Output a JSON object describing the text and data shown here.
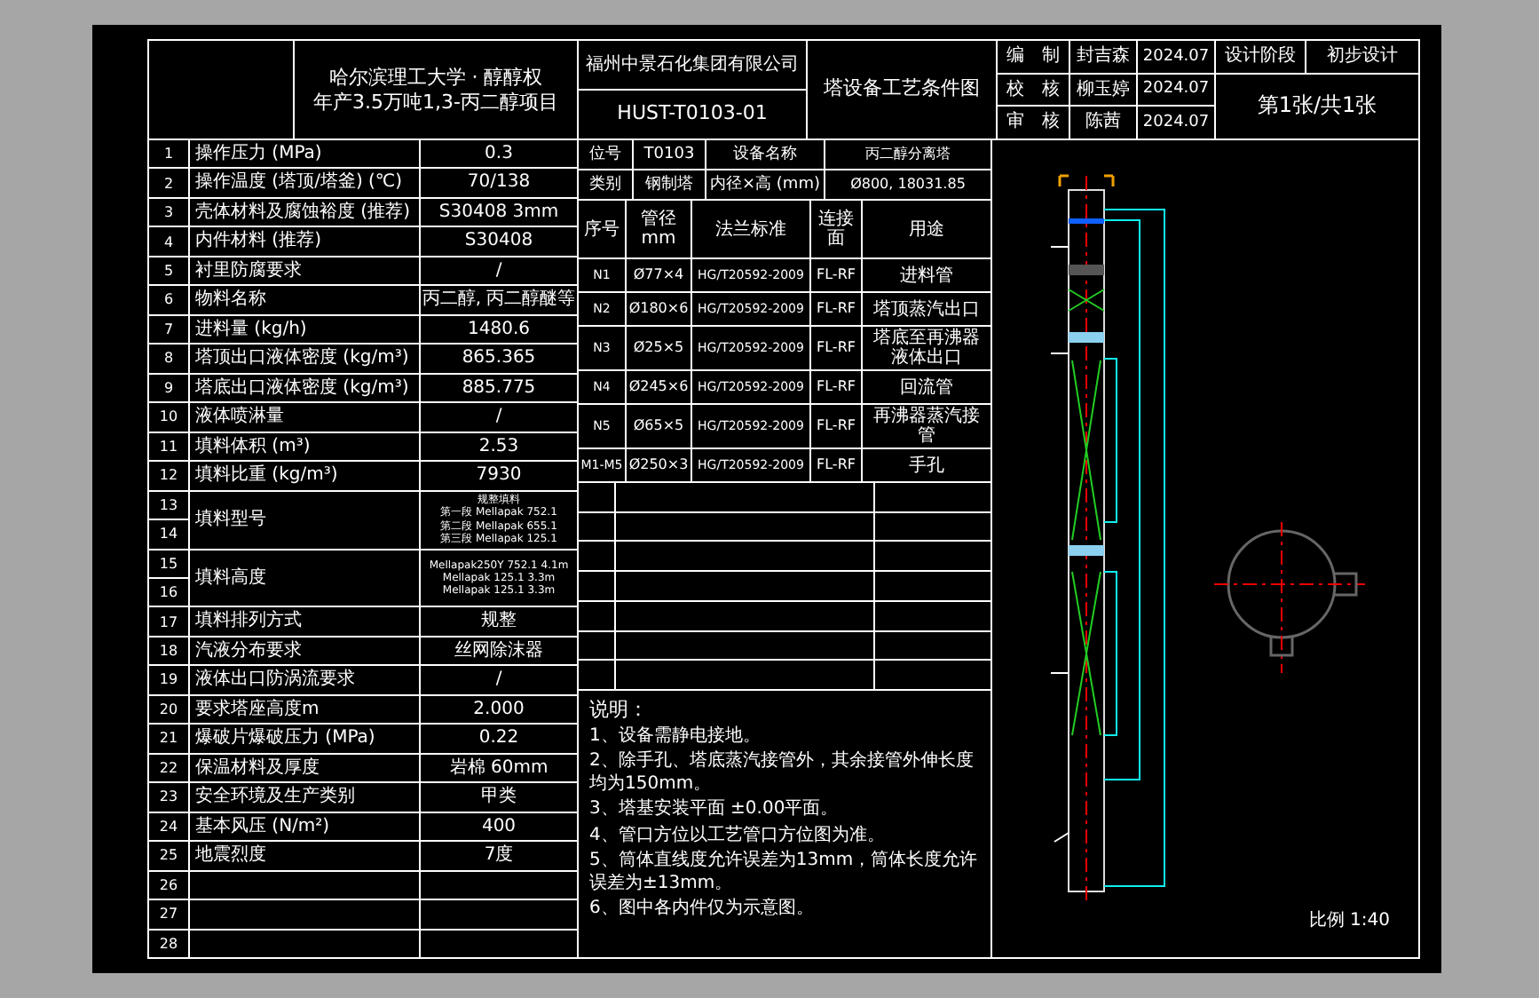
{
  "title_block": {
    "school": "哈尔滨理工大学 · 醇醇权",
    "project": "年产3.5万吨1,3-丙二醇项目",
    "company": "福州中景石化集团有限公司",
    "drawing_number": "HUST-T0103-01",
    "drawing_title": "塔设备工艺条件图",
    "signatures": [
      {
        "role": "编　制",
        "name": "封吉森",
        "date": "2024.07"
      },
      {
        "role": "校　核",
        "name": "柳玉婷",
        "date": "2024.07"
      },
      {
        "role": "审　核",
        "name": "陈茜",
        "date": "2024.07"
      }
    ],
    "stage_label": "设计阶段",
    "stage": "初步设计",
    "sheet": "第1张/共1张"
  },
  "conditions": [
    {
      "numbers": [
        "1"
      ],
      "item": "操作压力 (MPa)",
      "value": "0.3"
    },
    {
      "numbers": [
        "2"
      ],
      "item": "操作温度 (塔顶/塔釜) (℃)",
      "value": "70/138"
    },
    {
      "numbers": [
        "3"
      ],
      "item": "壳体材料及腐蚀裕度 (推荐)",
      "value": "S30408 3mm"
    },
    {
      "numbers": [
        "4"
      ],
      "item": "内件材料 (推荐)",
      "value": "S30408"
    },
    {
      "numbers": [
        "5"
      ],
      "item": "衬里防腐要求",
      "value": "/"
    },
    {
      "numbers": [
        "6"
      ],
      "item": "物料名称",
      "value": "丙二醇, 丙二醇醚等"
    },
    {
      "numbers": [
        "7"
      ],
      "item": "进料量 (kg/h)",
      "value": "1480.6"
    },
    {
      "numbers": [
        "8"
      ],
      "item": "塔顶出口液体密度 (kg/m³)",
      "value": "865.365"
    },
    {
      "numbers": [
        "9"
      ],
      "item": "塔底出口液体密度 (kg/m³)",
      "value": "885.775"
    },
    {
      "numbers": [
        "10"
      ],
      "item": "液体喷淋量",
      "value": "/"
    },
    {
      "numbers": [
        "11"
      ],
      "item": "填料体积 (m³)",
      "value": "2.53"
    },
    {
      "numbers": [
        "12"
      ],
      "item": "填料比重 (kg/m³)",
      "value": "7930"
    },
    {
      "numbers": [
        "13",
        "14"
      ],
      "item": "填料型号",
      "value": [
        "规整填料",
        "第一段 Mellapak 752.1",
        "第二段 Mellapak 655.1",
        "第三段 Mellapak 125.1"
      ]
    },
    {
      "numbers": [
        "15",
        "16"
      ],
      "item": "填料高度",
      "value": [
        "Mellapak250Y 752.1 4.1m",
        "Mellapak 125.1 3.3m",
        "Mellapak 125.1 3.3m"
      ]
    },
    {
      "numbers": [
        "17"
      ],
      "item": "填料排列方式",
      "value": "规整"
    },
    {
      "numbers": [
        "18"
      ],
      "item": "汽液分布要求",
      "value": "丝网除沫器"
    },
    {
      "numbers": [
        "19"
      ],
      "item": "液体出口防涡流要求",
      "value": "/"
    },
    {
      "numbers": [
        "20"
      ],
      "item": "要求塔座高度m",
      "value": "2.000"
    },
    {
      "numbers": [
        "21"
      ],
      "item": "爆破片爆破压力 (MPa)",
      "value": "0.22"
    },
    {
      "numbers": [
        "22"
      ],
      "item": "保温材料及厚度",
      "value": "岩棉 60mm"
    },
    {
      "numbers": [
        "23"
      ],
      "item": "安全环境及生产类别",
      "value": "甲类"
    },
    {
      "numbers": [
        "24"
      ],
      "item": "基本风压 (N/m²)",
      "value": "400"
    },
    {
      "numbers": [
        "25"
      ],
      "item": "地震烈度",
      "value": "7度"
    },
    {
      "numbers": [
        "26"
      ]
    },
    {
      "numbers": [
        "27"
      ]
    },
    {
      "numbers": [
        "28"
      ]
    }
  ],
  "equipment_rows": [
    {
      "cells": [
        "位号",
        "T0103",
        "设备名称",
        "丙二醇分离塔"
      ]
    },
    {
      "cells": [
        "类别",
        "钢制塔",
        "内径×高 (mm)",
        "Ø800, 18031.85"
      ]
    }
  ],
  "nozzles": {
    "columns": [
      "序号",
      "管径 mm",
      "法兰标准",
      "连接面",
      "用途"
    ],
    "rows": [
      {
        "cells": [
          "N1",
          "Ø77×4",
          "HG/T20592-2009",
          "FL-RF",
          "进料管"
        ]
      },
      {
        "cells": [
          "N2",
          "Ø180×6",
          "HG/T20592-2009",
          "FL-RF",
          "塔顶蒸汽出口"
        ]
      },
      {
        "cells": [
          "N3",
          "Ø25×5",
          "HG/T20592-2009",
          "FL-RF",
          "塔底至再沸器液体出口"
        ]
      },
      {
        "cells": [
          "N4",
          "Ø245×6",
          "HG/T20592-2009",
          "FL-RF",
          "回流管"
        ]
      },
      {
        "cells": [
          "N5",
          "Ø65×5",
          "HG/T20592-2009",
          "FL-RF",
          "再沸器蒸汽接管"
        ]
      },
      {
        "cells": [
          "M1-M5",
          "Ø250×3",
          "HG/T20592-2009",
          "FL-RF",
          "手孔"
        ]
      }
    ]
  },
  "notes": {
    "title": "说明：",
    "items": [
      "1、设备需静电接地。",
      "2、除手孔、塔底蒸汽接管外，其余接管外伸长度均为150mm。",
      "3、塔基安装平面 ±0.00平面。",
      "4、管口方位以工艺管口方位图为准。",
      "5、筒体直线度允许误差为13mm，筒体长度允许误差为±13mm。",
      "6、图中各内件仅为示意图。"
    ]
  },
  "scale": "比例 1:40"
}
